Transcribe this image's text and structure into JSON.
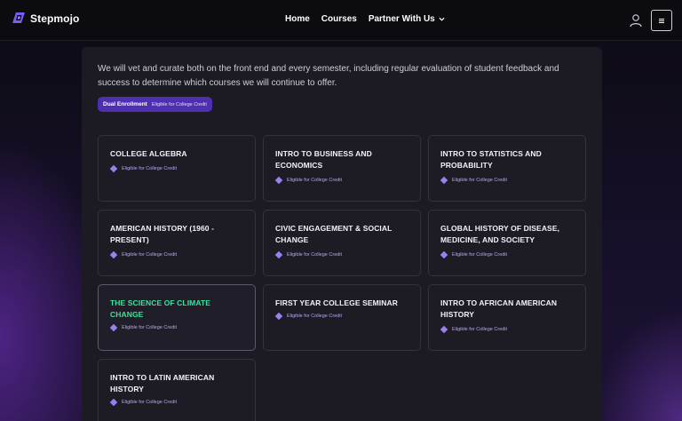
{
  "nav": {
    "brand": "Stepmojo",
    "items": [
      {
        "label": "Home"
      },
      {
        "label": "Courses"
      },
      {
        "label": "Partner With Us"
      }
    ]
  },
  "intro": {
    "text": "We will vet and curate both on the front end and every semester, including regular evaluation of student feedback and success to determine which courses we will continue to offer."
  },
  "pill": {
    "label": "Dual Enrollment",
    "sublabel": "Eligible for College Credit"
  },
  "courses": [
    {
      "title": "COLLEGE ALGEBRA",
      "badge": "Eligible for College Credit"
    },
    {
      "title": "INTRO TO BUSINESS AND ECONOMICS",
      "badge": "Eligible for College Credit"
    },
    {
      "title": "INTRO TO STATISTICS AND PROBABILITY",
      "badge": "Eligible for College Credit"
    },
    {
      "title": "AMERICAN HISTORY (1960 - PRESENT)",
      "badge": "Eligible for College Credit"
    },
    {
      "title": "CIVIC ENGAGEMENT & SOCIAL CHANGE",
      "badge": "Eligible for College Credit"
    },
    {
      "title": "GLOBAL HISTORY OF DISEASE, MEDICINE, AND SOCIETY",
      "badge": "Eligible for College Credit"
    },
    {
      "title": "THE SCIENCE OF CLIMATE CHANGE",
      "badge": "Eligible for College Credit"
    },
    {
      "title": "FIRST YEAR COLLEGE SEMINAR",
      "badge": "Eligible for College Credit"
    },
    {
      "title": "INTRO TO AFRICAN AMERICAN HISTORY",
      "badge": "Eligible for College Credit"
    },
    {
      "title": "INTRO TO LATIN AMERICAN HISTORY",
      "badge": "Eligible for College Credit"
    }
  ],
  "colors": {
    "accent": "#4d2fb0",
    "active_title": "#3ee29b",
    "badge": "#9b7ef0"
  },
  "icons": {
    "logo": "stepmojo-logo-icon",
    "user": "user-icon",
    "menu": "hamburger-icon",
    "chevron": "chevron-down-icon",
    "badge": "diamond-icon"
  }
}
